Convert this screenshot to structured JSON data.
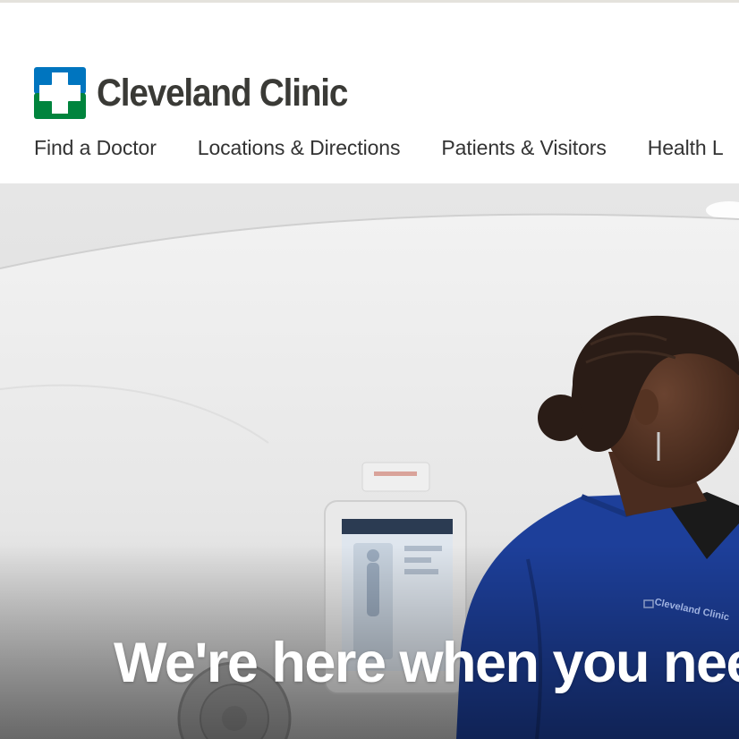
{
  "brand": {
    "name": "Cleveland Clinic",
    "colors": {
      "blue": "#0075bf",
      "green": "#00843d",
      "text": "#3a3a36"
    },
    "logo_icon": "cleveland-clinic-cross-icon"
  },
  "nav": {
    "items": [
      {
        "label": "Find a Doctor"
      },
      {
        "label": "Locations & Directions"
      },
      {
        "label": "Patients & Visitors"
      },
      {
        "label": "Health L"
      }
    ]
  },
  "hero": {
    "heading": "We're here when you nee",
    "badge_text": "Cleveland Clinic",
    "scrub_color": "#1d3f9a"
  }
}
